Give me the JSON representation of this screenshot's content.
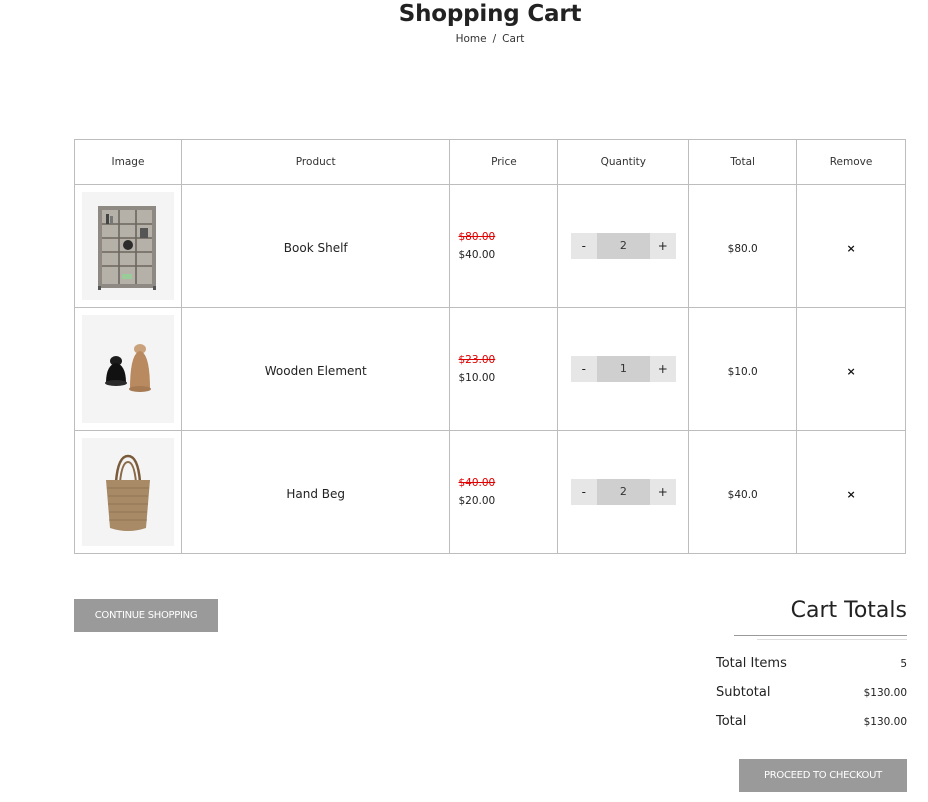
{
  "header": {
    "title": "Shopping Cart",
    "breadcrumb": {
      "home": "Home",
      "separator": "/",
      "current": "Cart"
    }
  },
  "table": {
    "headers": {
      "image": "Image",
      "product": "Product",
      "price": "Price",
      "quantity": "Quantity",
      "total": "Total",
      "remove": "Remove"
    },
    "rows": [
      {
        "image_icon": "bookshelf-image",
        "name": "Book Shelf",
        "old_price": "$80.00",
        "price": "$40.00",
        "qty_minus": "-",
        "quantity": "2",
        "qty_plus": "+",
        "total": "$80.0",
        "remove": "×"
      },
      {
        "image_icon": "wooden-element-image",
        "name": "Wooden Element",
        "old_price": "$23.00",
        "price": "$10.00",
        "qty_minus": "-",
        "quantity": "1",
        "qty_plus": "+",
        "total": "$10.0",
        "remove": "×"
      },
      {
        "image_icon": "hand-bag-image",
        "name": "Hand Beg",
        "old_price": "$40.00",
        "price": "$20.00",
        "qty_minus": "-",
        "quantity": "2",
        "qty_plus": "+",
        "total": "$40.0",
        "remove": "×"
      }
    ]
  },
  "actions": {
    "continue_label": "CONTINUE SHOPPING",
    "checkout_label": "PROCEED TO CHECKOUT"
  },
  "totals": {
    "title": "Cart Totals",
    "items_label": "Total Items",
    "items_value": "5",
    "subtotal_label": "Subtotal",
    "subtotal_value": "$130.00",
    "total_label": "Total",
    "total_value": "$130.00"
  },
  "colors": {
    "old_price": "#e00000",
    "button_bg": "#9a9a9a",
    "qty_value_bg": "#cfcfcf",
    "thumb_bg": "#f4f4f4"
  }
}
